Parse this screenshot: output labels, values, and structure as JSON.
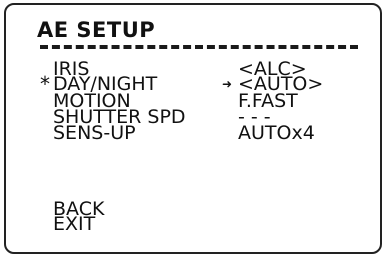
{
  "screen": {
    "title": "AE SETUP"
  },
  "menu": {
    "current_marker": "*",
    "selection_arrow": "➜",
    "items": [
      {
        "label": "IRIS",
        "value": "<ALC>"
      },
      {
        "label": "DAY/NIGHT",
        "value": "<AUTO>"
      },
      {
        "label": "MOTION",
        "value": "F.FAST"
      },
      {
        "label": "SHUTTER SPD",
        "value": "- - -"
      },
      {
        "label": "SENS-UP",
        "value": "AUTOx4"
      }
    ],
    "back_label": "BACK",
    "exit_label": "EXIT"
  }
}
